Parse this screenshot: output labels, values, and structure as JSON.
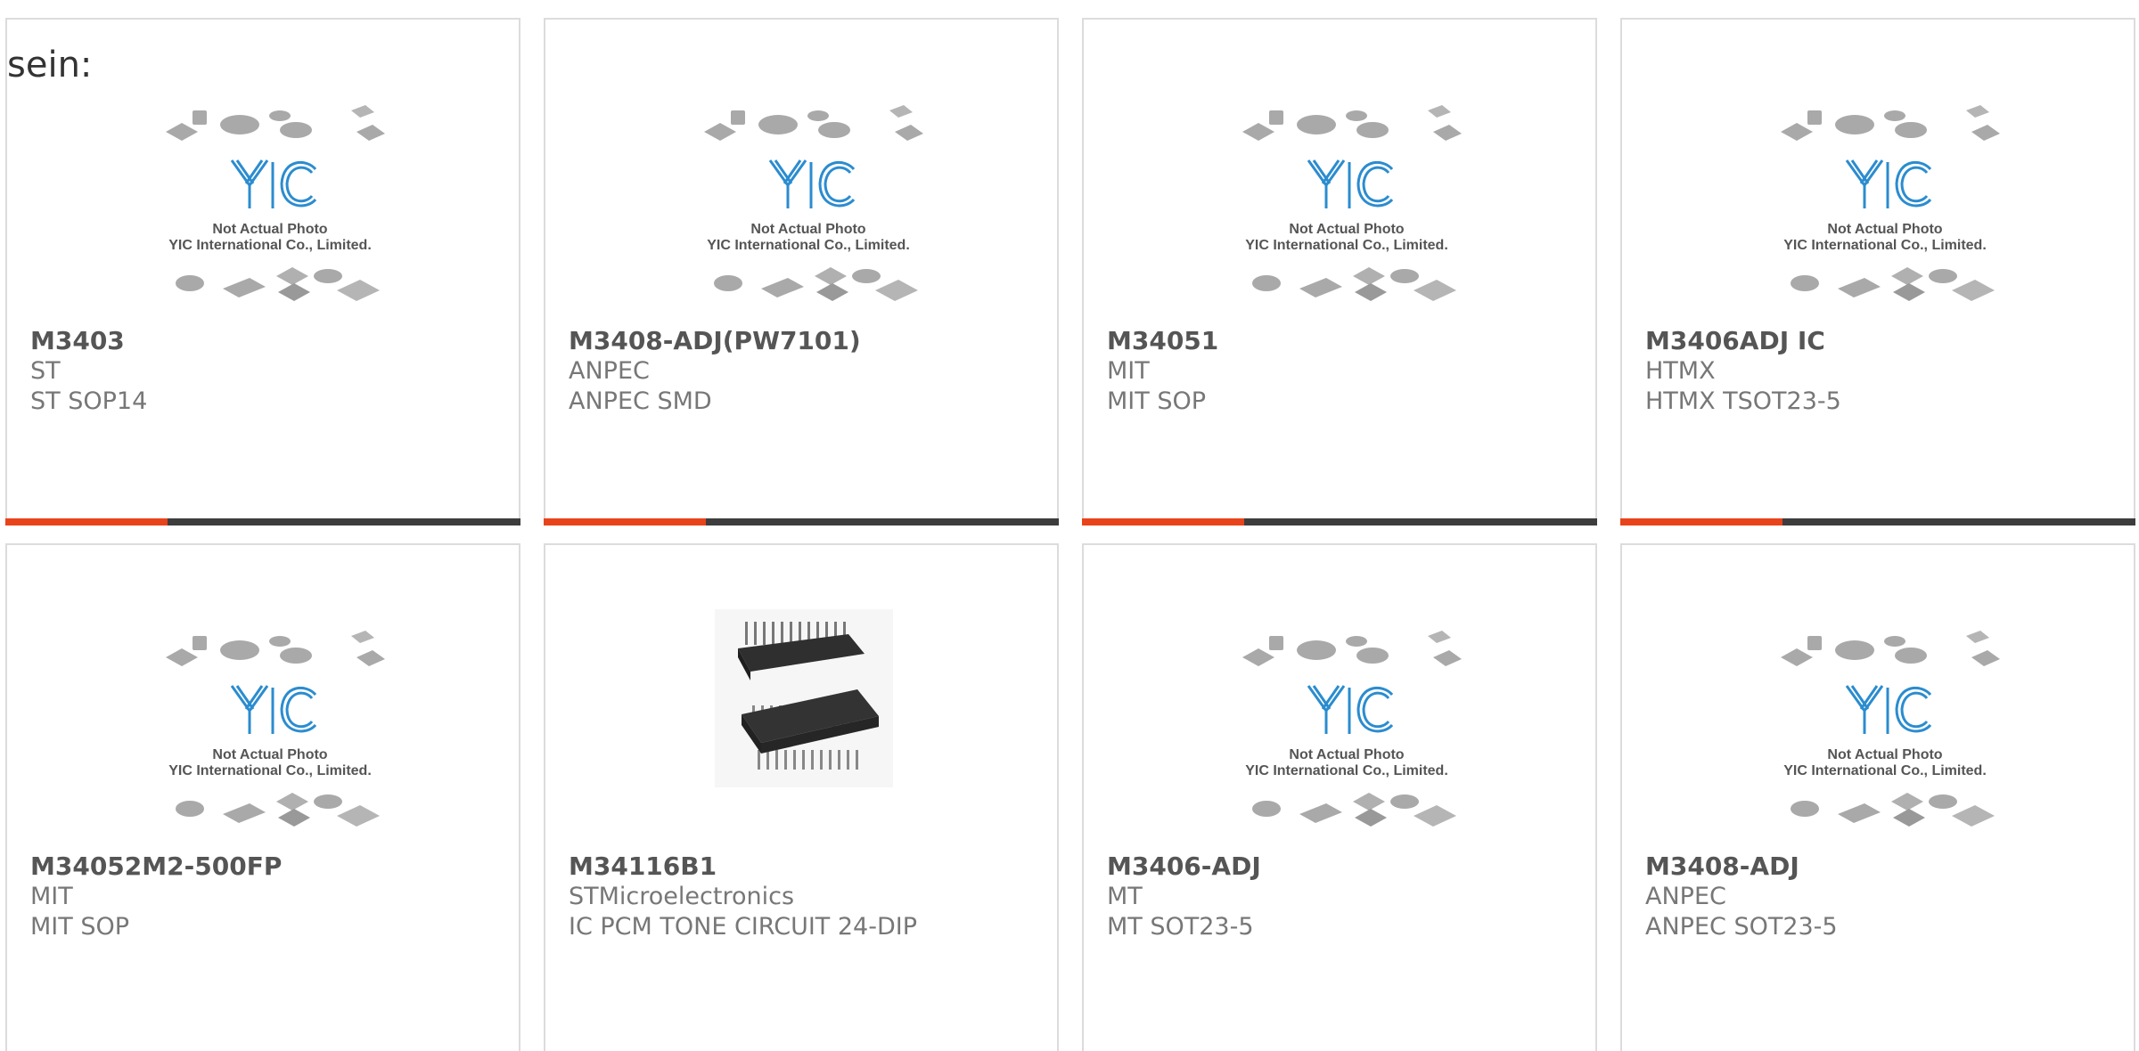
{
  "intro_text": "sein:",
  "placeholder": {
    "line1": "Not Actual Photo",
    "line2": "YIC International Co., Limited.",
    "logo": "YIC"
  },
  "colors": {
    "accent": "#e8431a",
    "bar_dark": "#3d3d3d",
    "logo_blue": "#2b8ccf"
  },
  "products": [
    {
      "name": "M3403",
      "maker": "ST",
      "desc": "ST SOP14",
      "image": "placeholder"
    },
    {
      "name": "M3408-ADJ(PW7101)",
      "maker": "ANPEC",
      "desc": "ANPEC SMD",
      "image": "placeholder"
    },
    {
      "name": "M34051",
      "maker": "MIT",
      "desc": "MIT SOP",
      "image": "placeholder"
    },
    {
      "name": "M3406ADJ IC",
      "maker": "HTMX",
      "desc": "HTMX TSOT23-5",
      "image": "placeholder"
    },
    {
      "name": "M34052M2-500FP",
      "maker": "MIT",
      "desc": "MIT SOP",
      "image": "placeholder"
    },
    {
      "name": "M34116B1",
      "maker": "STMicroelectronics",
      "desc": "IC PCM TONE CIRCUIT 24-DIP",
      "image": "dip-chip-photo"
    },
    {
      "name": "M3406-ADJ",
      "maker": "MT",
      "desc": "MT SOT23-5",
      "image": "placeholder"
    },
    {
      "name": "M3408-ADJ",
      "maker": "ANPEC",
      "desc": "ANPEC SOT23-5",
      "image": "placeholder"
    }
  ]
}
